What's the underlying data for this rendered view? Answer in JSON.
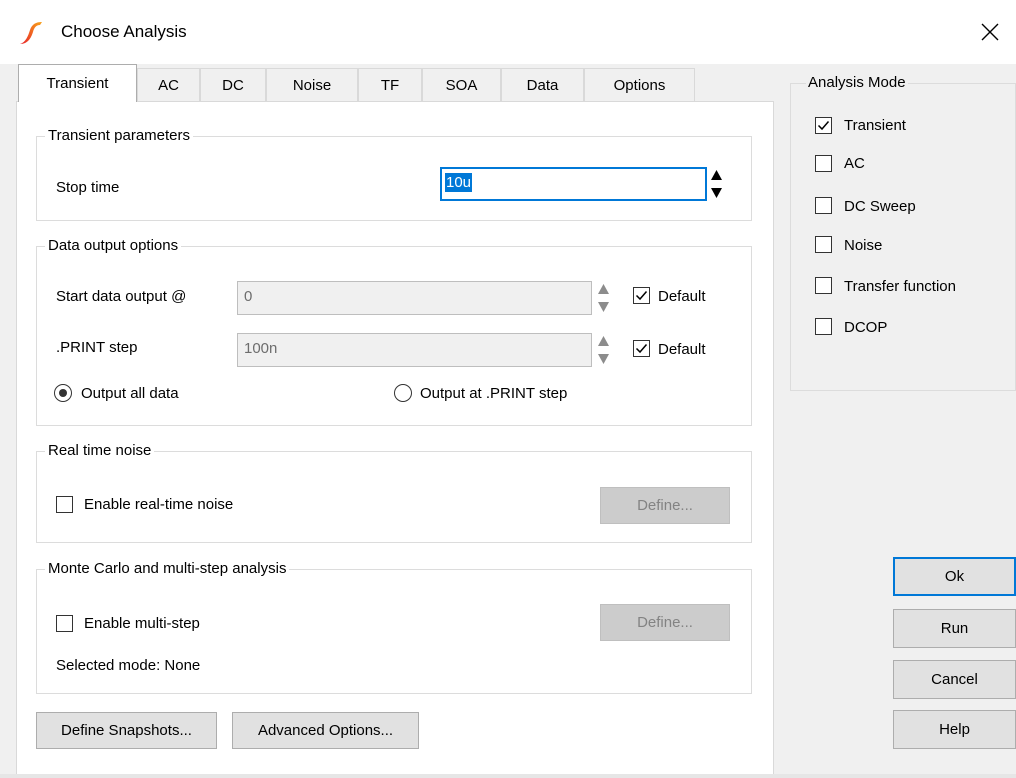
{
  "window": {
    "title": "Choose Analysis",
    "close_label": "×"
  },
  "tabs": [
    {
      "label": "Transient",
      "active": true
    },
    {
      "label": "AC",
      "active": false
    },
    {
      "label": "DC",
      "active": false
    },
    {
      "label": "Noise",
      "active": false
    },
    {
      "label": "TF",
      "active": false
    },
    {
      "label": "SOA",
      "active": false
    },
    {
      "label": "Data",
      "active": false
    },
    {
      "label": "Options",
      "active": false
    }
  ],
  "transient_parameters": {
    "title": "Transient parameters",
    "stop_time_label": "Stop time",
    "stop_time_value": "10u"
  },
  "data_output": {
    "title": "Data output options",
    "start_label": "Start data output @",
    "start_value": "0",
    "start_default_label": "Default",
    "start_default_checked": true,
    "print_step_label": ".PRINT step",
    "print_step_value": "100n",
    "print_default_label": "Default",
    "print_default_checked": true,
    "radio_all_label": "Output all data",
    "radio_all_selected": true,
    "radio_print_label": "Output at .PRINT step",
    "radio_print_selected": false
  },
  "real_time_noise": {
    "title": "Real time noise",
    "enable_label": "Enable real-time noise",
    "enable_checked": false,
    "define_label": "Define..."
  },
  "monte_carlo": {
    "title": "Monte Carlo and multi-step analysis",
    "enable_label": "Enable multi-step",
    "enable_checked": false,
    "define_label": "Define...",
    "selected_mode_text": "Selected mode: None"
  },
  "bottom_buttons": {
    "snapshots_label": "Define Snapshots...",
    "advanced_label": "Advanced Options..."
  },
  "analysis_mode": {
    "title": "Analysis Mode",
    "items": [
      {
        "label": "Transient",
        "checked": true
      },
      {
        "label": "AC",
        "checked": false
      },
      {
        "label": "DC Sweep",
        "checked": false
      },
      {
        "label": "Noise",
        "checked": false
      },
      {
        "label": "Transfer function",
        "checked": false
      },
      {
        "label": "DCOP",
        "checked": false
      }
    ]
  },
  "dialog_buttons": {
    "ok_label": "Ok",
    "run_label": "Run",
    "cancel_label": "Cancel",
    "help_label": "Help"
  },
  "colors": {
    "accent": "#0078d7",
    "icon_red": "#e8232a",
    "icon_orange": "#f7a21b"
  }
}
